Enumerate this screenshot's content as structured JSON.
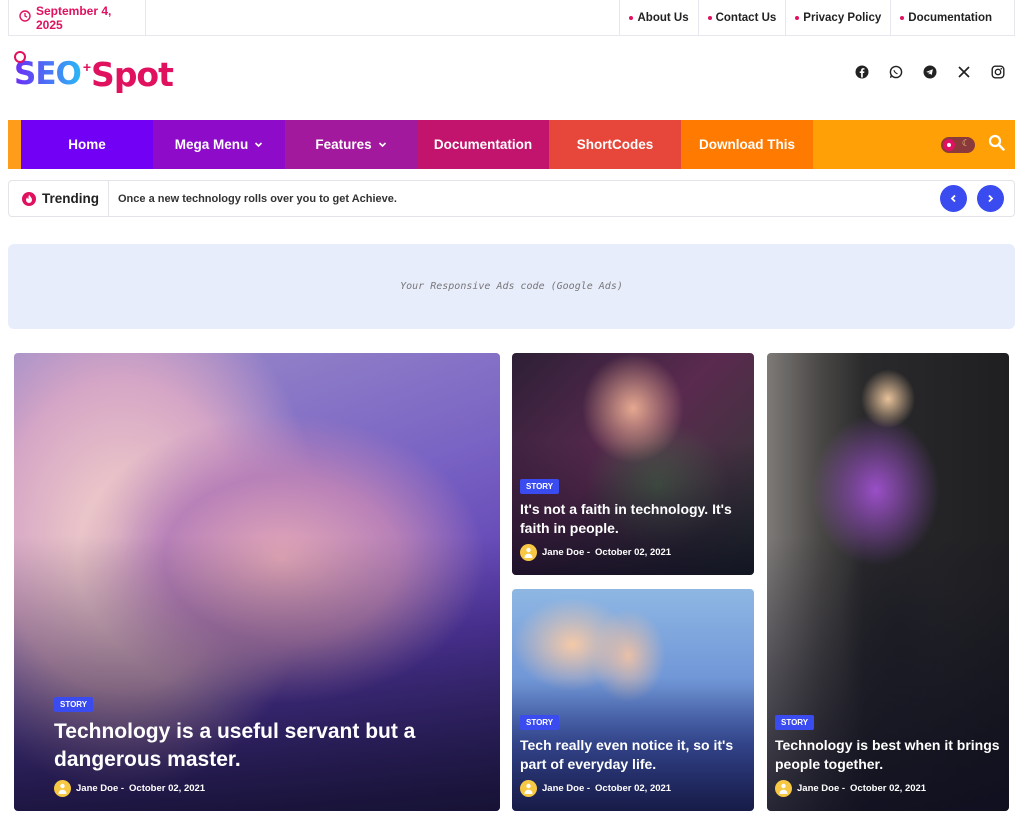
{
  "topbar": {
    "date": "September 4, 2025",
    "links": [
      "About Us",
      "Contact Us",
      "Privacy Policy",
      "Documentation"
    ]
  },
  "logo": {
    "part1": "SEO",
    "part2": "Spot"
  },
  "socials": [
    "facebook-icon",
    "whatsapp-icon",
    "telegram-icon",
    "x-icon",
    "instagram-icon"
  ],
  "nav": {
    "items": [
      {
        "label": "Home",
        "color": "#7100f5"
      },
      {
        "label": "Mega Menu",
        "color": "#8e0cc9"
      },
      {
        "label": "Features",
        "color": "#a2199e"
      },
      {
        "label": "Documentation",
        "color": "#c2146c"
      },
      {
        "label": "ShortCodes",
        "color": "#e7463a"
      },
      {
        "label": "Download This",
        "color": "#ff7a00"
      }
    ]
  },
  "trending": {
    "label": "Trending",
    "headline": "Once a new technology rolls over you to get Achieve."
  },
  "ads": {
    "text": "Your Responsive Ads code (Google Ads)"
  },
  "posts": [
    {
      "badge": "STORY",
      "title": "Technology is a useful servant but a dangerous master.",
      "author": "Jane Doe -",
      "date": "October 02, 2021"
    },
    {
      "badge": "STORY",
      "title": "It's not a faith in technology. It's faith in people.",
      "author": "Jane Doe -",
      "date": "October 02, 2021"
    },
    {
      "badge": "STORY",
      "title": "Tech really even notice it, so it's part of everyday life.",
      "author": "Jane Doe -",
      "date": "October 02, 2021"
    },
    {
      "badge": "STORY",
      "title": "Technology is best when it brings people together.",
      "author": "Jane Doe -",
      "date": "October 02, 2021"
    }
  ],
  "colors": {
    "accent": "#e0115f",
    "blue": "#3a4bef"
  }
}
